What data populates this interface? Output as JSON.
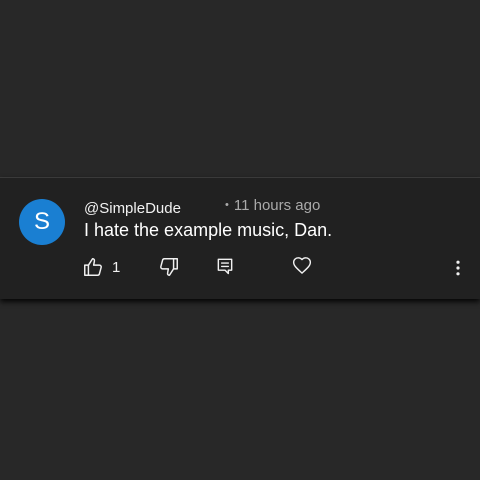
{
  "comment": {
    "avatar_letter": "S",
    "avatar_color": "#1a7fd2",
    "username": "@SimpleDude",
    "timestamp": "11 hours ago",
    "text": "I hate the example music, Dan.",
    "like_count": "1"
  },
  "icons": {
    "like": "thumbs-up-icon",
    "dislike": "thumbs-down-icon",
    "reply": "reply-comment-icon",
    "heart": "heart-icon",
    "more": "more-vertical-icon"
  }
}
